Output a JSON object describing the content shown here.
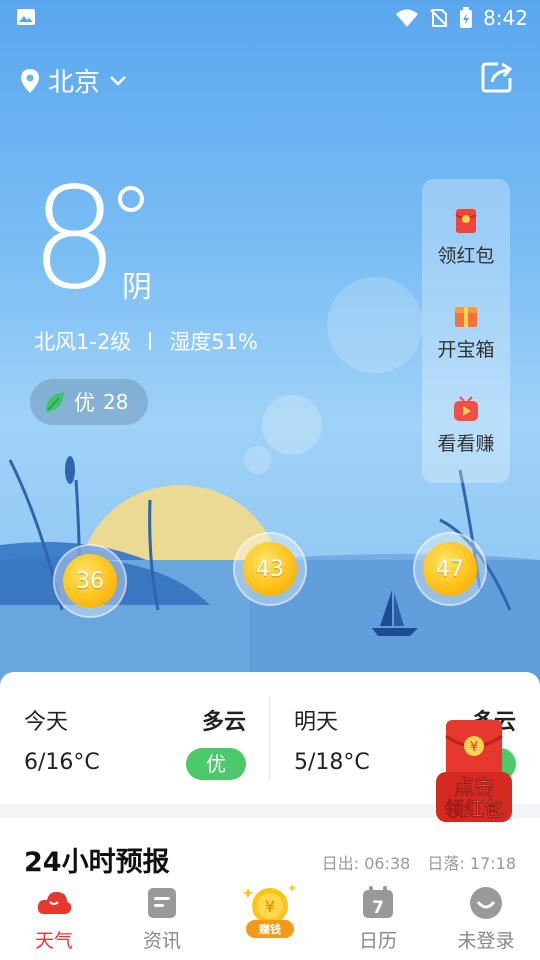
{
  "status_bar": {
    "time": "8:42"
  },
  "header": {
    "city": "北京"
  },
  "current": {
    "temperature": "8",
    "condition": "阴",
    "wind": "北风1-2级",
    "humidity": "湿度51%",
    "aqi_label": "优",
    "aqi_value": "28"
  },
  "side_menu": [
    {
      "label": "领红包",
      "icon": "red-envelope-icon"
    },
    {
      "label": "开宝箱",
      "icon": "treasure-box-icon"
    },
    {
      "label": "看看赚",
      "icon": "video-play-icon"
    }
  ],
  "coins": [
    "36",
    "43",
    "47"
  ],
  "forecast": [
    {
      "day": "今天",
      "weather": "多云",
      "range": "6/16°C",
      "quality": "优"
    },
    {
      "day": "明天",
      "weather": "多云",
      "range": "5/18°C",
      "quality": "优"
    }
  ],
  "promo": {
    "line1": "点击",
    "line2": "领红包"
  },
  "hourly": {
    "title": "24小时预报",
    "sunrise": "日出: 06:38",
    "sunset": "日落: 17:18"
  },
  "tabs": [
    {
      "label": "天气",
      "icon": "weather-cloud-icon",
      "active": true
    },
    {
      "label": "资讯",
      "icon": "news-icon",
      "active": false
    },
    {
      "label": "赚钱",
      "icon": "coin-icon",
      "active": false
    },
    {
      "label": "日历",
      "icon": "calendar-icon",
      "active": false,
      "day": "7"
    },
    {
      "label": "未登录",
      "icon": "user-avatar-icon",
      "active": false
    }
  ],
  "colors": {
    "accent_red": "#e8372f",
    "quality_green": "#4cc96a",
    "sky_blue": "#79bdf4",
    "coin_gold": "#ffc21a"
  }
}
